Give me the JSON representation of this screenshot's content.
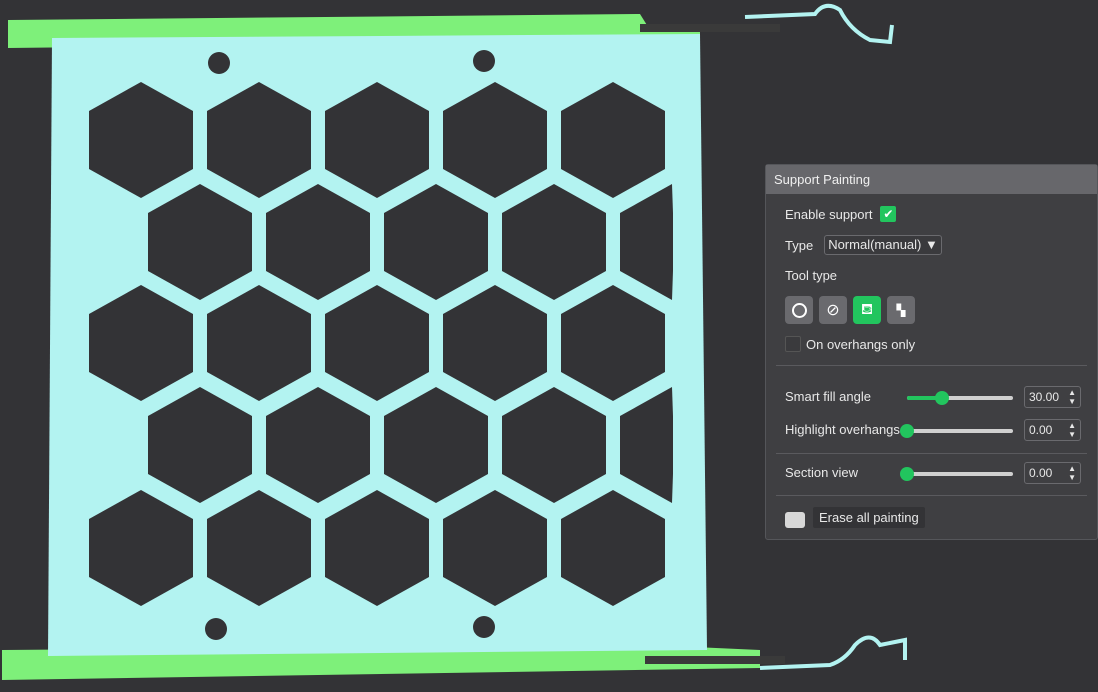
{
  "panel": {
    "title": "Support Painting",
    "enable_support": {
      "label": "Enable support",
      "checked": true
    },
    "type": {
      "label": "Type",
      "value": "Normal(manual)"
    },
    "tool_type": {
      "label": "Tool type",
      "tools": [
        {
          "icon": "circle-brush-icon",
          "active": false
        },
        {
          "icon": "sphere-brush-icon",
          "active": false
        },
        {
          "icon": "fill-bucket-icon",
          "active": true
        },
        {
          "icon": "gap-fill-icon",
          "active": false
        }
      ]
    },
    "overhangs_only": {
      "label": "On overhangs only",
      "checked": false
    },
    "smart_fill_angle": {
      "label": "Smart fill angle",
      "value": "30.00",
      "fraction": 0.33
    },
    "highlight_overhangs": {
      "label": "Highlight overhangs",
      "value": "0.00",
      "fraction": 0
    },
    "section_view": {
      "label": "Section view",
      "value": "0.00",
      "fraction": 0
    },
    "erase_label": "Erase all painting"
  },
  "colors": {
    "accent": "#22c55e",
    "plate": "#b3f3f1",
    "rail": "#7ef07a"
  }
}
